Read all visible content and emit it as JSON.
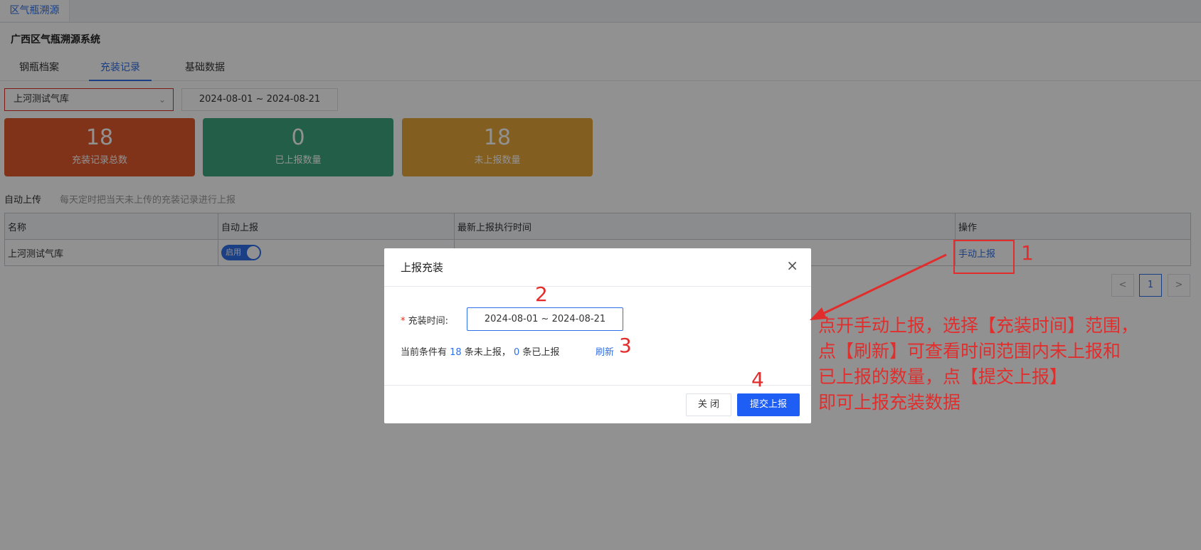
{
  "top_tab": "区气瓶溯源",
  "system_title": "广西区气瓶溯源系统",
  "tabs": [
    {
      "label": "钢瓶档案",
      "active": false
    },
    {
      "label": "充装记录",
      "active": true
    },
    {
      "label": "基础数据",
      "active": false
    }
  ],
  "filters": {
    "station": "上河测试气库",
    "date_range": "2024-08-01  ~  2024-08-21"
  },
  "stats": [
    {
      "value": "18",
      "label": "充装记录总数",
      "color": "#e25b2c"
    },
    {
      "value": "0",
      "label": "已上报数量",
      "color": "#3da67f"
    },
    {
      "value": "18",
      "label": "未上报数量",
      "color": "#e5a53b"
    }
  ],
  "auto_upload": {
    "label": "自动上传",
    "hint": "每天定时把当天未上传的充装记录进行上报"
  },
  "table": {
    "columns": [
      "名称",
      "自动上报",
      "最新上报执行时间",
      "操作"
    ],
    "rows": [
      {
        "name": "上河测试气库",
        "auto": "启用",
        "last_time": "",
        "action": "手动上报"
      }
    ]
  },
  "pagination": {
    "prev": "<",
    "current": "1",
    "next": ">"
  },
  "dialog": {
    "title": "上报充装",
    "close_icon": "×",
    "field_label": "充装时间:",
    "required_mark": "*",
    "date_range": "2024-08-01  ~  2024-08-21",
    "summary_prefix": "当前条件有",
    "unreported_count": "18",
    "summary_mid": "条未上报，",
    "reported_count": "0",
    "summary_suffix": "条已上报",
    "refresh": "刷新",
    "close_button": "关 闭",
    "submit_button": "提交上报"
  },
  "annotations": {
    "markers": [
      "1",
      "2",
      "3",
      "4"
    ],
    "note_lines": [
      "点开手动上报，选择【充装时间】范围，",
      "点【刷新】可查看时间范围内未上报和",
      "已上报的数量，点【提交上报】",
      "即可上报充装数据"
    ],
    "color": "#e22d2d"
  }
}
